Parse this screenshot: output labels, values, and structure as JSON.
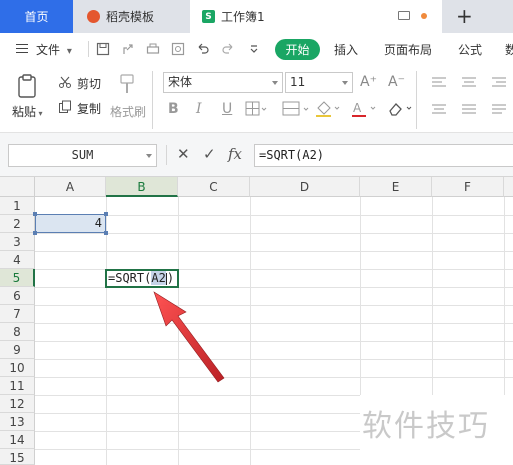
{
  "tabs": {
    "home": "首页",
    "template": "稻壳模板",
    "workbook": "工作簿1",
    "workbook_icon": "S",
    "new_tab": "+"
  },
  "menu": {
    "file": "文件",
    "file_arrow": "▾",
    "start": "开始",
    "insert": "插入",
    "layout": "页面布局",
    "formula": "公式",
    "data": "数"
  },
  "ribbon": {
    "paste": "粘贴",
    "cut": "剪切",
    "copy": "复制",
    "format_painter": "格式刷",
    "font_name": "宋体",
    "font_size": "11",
    "grow": "A⁺",
    "shrink": "A⁻",
    "bold": "B",
    "italic": "I",
    "underline": "U"
  },
  "formula_bar": {
    "name_box": "SUM",
    "cancel": "✕",
    "confirm": "✓",
    "fx": "fx",
    "formula": "=SQRT(A2)"
  },
  "sheet": {
    "columns": [
      "A",
      "B",
      "C",
      "D",
      "E",
      "F"
    ],
    "rows": [
      "1",
      "2",
      "3",
      "4",
      "5",
      "6",
      "7",
      "8",
      "9",
      "10",
      "11",
      "12",
      "13",
      "14",
      "15"
    ],
    "a2_value": "4",
    "b5_prefix": "=SQRT(",
    "b5_ref": "A2",
    "b5_suffix": ")"
  },
  "watermark": "软件技巧",
  "colors": {
    "accent_green": "#1aa664",
    "excel_green": "#217346",
    "home_tab_blue": "#2f6ee8",
    "arrow_red": "#d8262b"
  }
}
